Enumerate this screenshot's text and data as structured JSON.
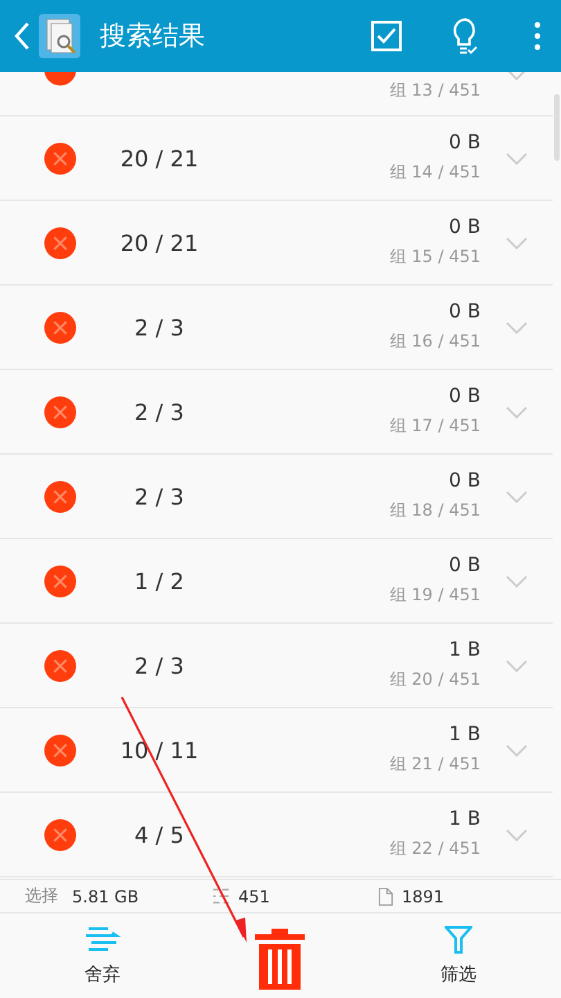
{
  "header": {
    "title": "搜索结果"
  },
  "groups": [
    {
      "group": "组 13 / 451"
    },
    {
      "count": "20 / 21",
      "size": "0 B",
      "group": "组 14 / 451"
    },
    {
      "count": "20 / 21",
      "size": "0 B",
      "group": "组 15 / 451"
    },
    {
      "count": "2 / 3",
      "size": "0 B",
      "group": "组 16 / 451"
    },
    {
      "count": "2 / 3",
      "size": "0 B",
      "group": "组 17 / 451"
    },
    {
      "count": "2 / 3",
      "size": "0 B",
      "group": "组 18 / 451"
    },
    {
      "count": "1 / 2",
      "size": "0 B",
      "group": "组 19 / 451"
    },
    {
      "count": "2 / 3",
      "size": "1 B",
      "group": "组 20 / 451"
    },
    {
      "count": "10 / 11",
      "size": "1 B",
      "group": "组 21 / 451"
    },
    {
      "count": "4 / 5",
      "size": "1 B",
      "group": "组 22 / 451"
    }
  ],
  "status_bar": {
    "selected_label": "选择",
    "selected_size": "5.81 GB",
    "groups": "451",
    "files": "1891"
  },
  "bottom_bar": {
    "discard": "舍弃",
    "filter": "筛选"
  }
}
